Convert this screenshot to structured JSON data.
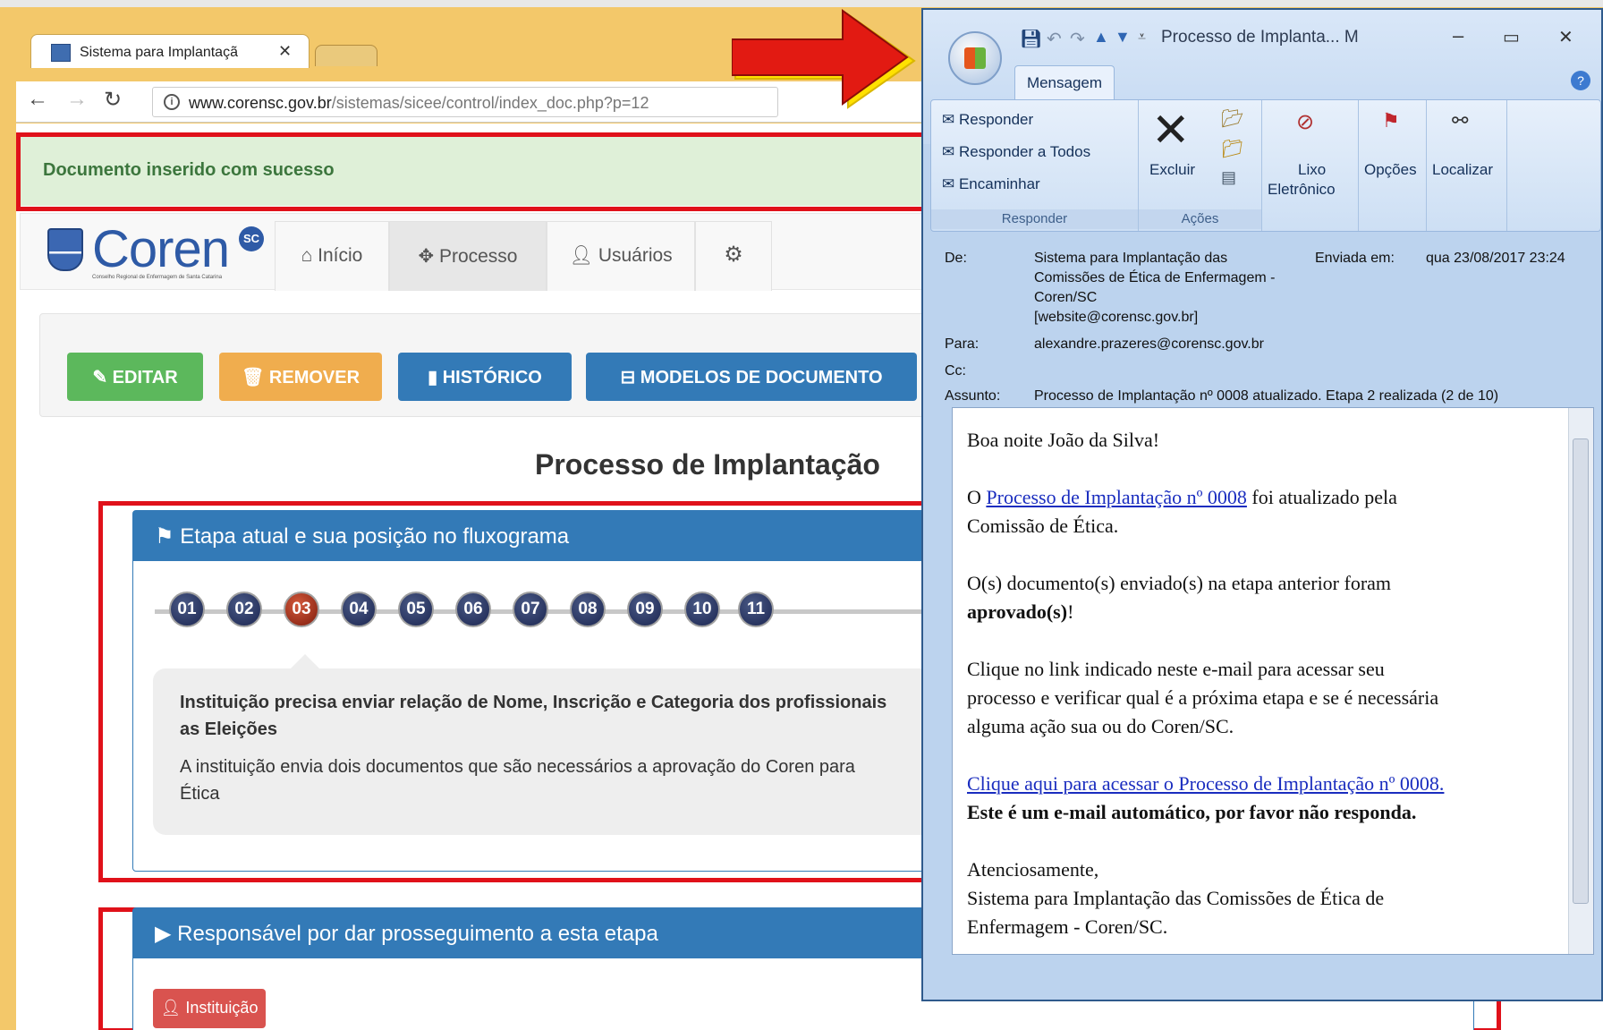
{
  "browser": {
    "tab_title": "Sistema para Implantaçã",
    "url_domain": "www.corensc.gov.br",
    "url_path": "/sistemas/sicee/control/index_doc.php?p=12"
  },
  "alert": {
    "text": "Documento inserido com sucesso"
  },
  "logo": {
    "text": "Coren",
    "badge": "SC",
    "subtext": "Conselho Regional de Enfermagem de Santa Catarina"
  },
  "nav": {
    "inicio": "Início",
    "processo": "Processo",
    "usuarios": "Usuários"
  },
  "actions": {
    "editar": "EDITAR",
    "remover": "REMOVER",
    "historico": "HISTÓRICO",
    "modelos": "MODELOS DE DOCUMENTO"
  },
  "page_title": "Processo de Implantação",
  "etapa_panel": {
    "title": "Etapa atual e sua posição no fluxograma",
    "steps": [
      "01",
      "02",
      "03",
      "04",
      "05",
      "06",
      "07",
      "08",
      "09",
      "10",
      "11"
    ],
    "current_step": "03",
    "desc_bold": "Instituição precisa enviar relação de Nome, Inscrição e Categoria dos profissionais",
    "desc_bold2": "as Eleições",
    "desc": "A instituição envia dois documentos que são necessários a aprovação do Coren para",
    "desc2": "Ética"
  },
  "resp_panel": {
    "title": "Responsável por dar prosseguimento a esta etapa",
    "button": "Instituição"
  },
  "outlook": {
    "title": "Processo de Implanta... M",
    "tab": "Mensagem",
    "responder": "Responder",
    "responder_todos": "Responder a Todos",
    "encaminhar": "Encaminhar",
    "group_responder": "Responder",
    "excluir": "Excluir",
    "group_acoes": "Ações",
    "lixo": "Lixo",
    "eletronico": "Eletrônico",
    "opcoes": "Opções",
    "localizar": "Localizar",
    "de_label": "De:",
    "de_1": "Sistema para Implantação das",
    "de_2": "Comissões de Ética de Enfermagem -",
    "de_3": "Coren/SC",
    "de_4": "[website@corensc.gov.br]",
    "enviada_label": "Enviada em:",
    "enviada": "qua 23/08/2017 23:24",
    "para_label": "Para:",
    "para": "alexandre.prazeres@corensc.gov.br",
    "cc_label": "Cc:",
    "assunto_label": "Assunto:",
    "assunto": "Processo de Implantação nº 0008 atualizado. Etapa 2 realizada (2 de 10)",
    "greeting": "Boa noite João da Silva!",
    "p1_a": "O ",
    "p1_link": "Processo de Implantação nº 0008",
    "p1_b": " foi atualizado pela",
    "p1_c": "Comissão de Ética.",
    "p2_a": "O(s) documento(s) enviado(s) na etapa anterior foram",
    "p2_b": "aprovado(s)",
    "p2_c": "!",
    "p3_a": "Clique no link indicado neste e-mail para acessar seu",
    "p3_b": "processo e verificar qual é a próxima etapa e se é necessária",
    "p3_c": "alguma ação sua ou do Coren/SC.",
    "link": "Clique aqui para acessar o Processo de Implantação nº 0008.",
    "auto": "Este é um e-mail automático, por favor não responda.",
    "sign1": "Atenciosamente,",
    "sign2": "Sistema para Implantação das Comissões de Ética de",
    "sign3": "Enfermagem - Coren/SC."
  }
}
